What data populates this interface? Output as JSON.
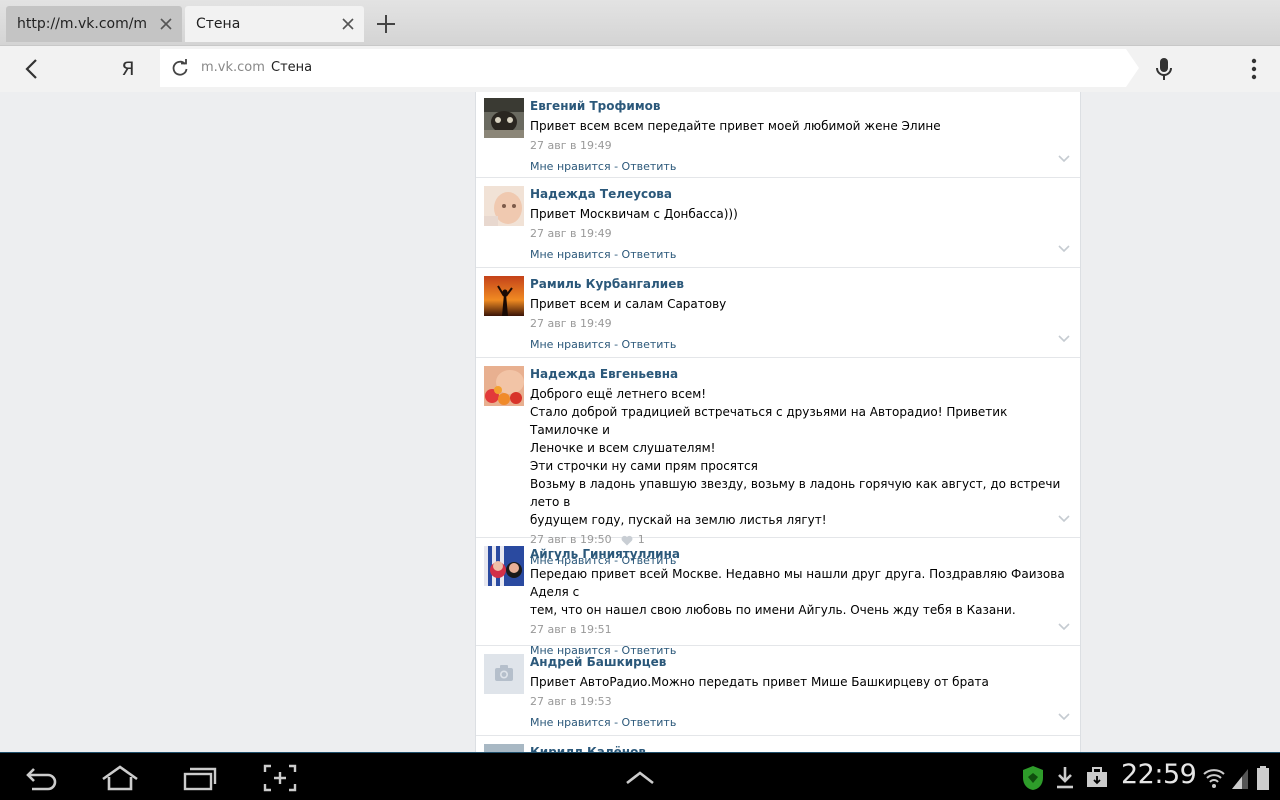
{
  "browser": {
    "tabs": [
      {
        "title": "http://m.vk.com/mail?",
        "active": false
      },
      {
        "title": "Стена",
        "active": true
      }
    ],
    "address": {
      "domain": "m.vk.com",
      "page_title": "Стена"
    },
    "ya_label": "Я"
  },
  "comments": [
    {
      "author": "Евгений Трофимов",
      "text": [
        "Привет всем всем передайте привет моей любимой жене Элине"
      ],
      "time": "27 авг в 19:49",
      "likes": null
    },
    {
      "author": "Надежда Телеусова",
      "text": [
        "Привет Москвичам с Донбасса)))"
      ],
      "time": "27 авг в 19:49",
      "likes": null
    },
    {
      "author": "Рамиль Курбангалиев",
      "text": [
        "Привет всем и салам Саратову"
      ],
      "time": "27 авг в 19:49",
      "likes": null
    },
    {
      "author": "Надежда Евгеньевна",
      "text": [
        "Доброго ещё летнего всем!",
        "Стало доброй традицией встречаться с друзьями на Авторадио! Приветик Тамилочке и",
        "Леночке и всем слушателям!",
        "Эти строчки ну сами прям просятся",
        "Возьму в ладонь упавшую звезду, возьму в ладонь горячую как август, до встречи лето в",
        "будущем году, пускай на землю листья лягут!"
      ],
      "time": "27 авг в 19:50",
      "likes": "1"
    },
    {
      "author": "Айгуль Гиниятуллина",
      "text": [
        "Передаю привет всей Москве. Недавно мы нашли друг друга. Поздравляю Фаизова Аделя с",
        "тем, что он нашел свою любовь по имени Айгуль. Очень жду тебя в Казани."
      ],
      "time": "27 авг в 19:51",
      "likes": null
    },
    {
      "author": "Андрей Башкирцев",
      "text": [
        "Привет АвтоРадио.Можно передать привет Мише Башкирцеву от брата"
      ],
      "time": "27 авг в 19:53",
      "likes": null
    },
    {
      "author": "Кирилл Калёнов",
      "text": [],
      "time": "",
      "likes": null
    }
  ],
  "actions": {
    "like": "Мне нравится",
    "separator": " - ",
    "reply": "Ответить"
  },
  "status": {
    "clock": "22:59"
  },
  "colors": {
    "link": "#2b587a",
    "meta": "#999999",
    "page_bg": "#edeef0",
    "navbar": "#000000"
  },
  "icons": [
    "close-icon",
    "plus-icon",
    "back-arrow-icon",
    "reload-icon",
    "microphone-icon",
    "overflow-menu-icon",
    "chevron-down-icon",
    "heart-icon",
    "camera-icon",
    "nav-back-icon",
    "home-icon",
    "recent-apps-icon",
    "screenshot-icon",
    "chevron-up-icon",
    "shield-icon",
    "download-icon",
    "briefcase-icon",
    "wifi-icon",
    "signal-icon",
    "battery-icon"
  ]
}
